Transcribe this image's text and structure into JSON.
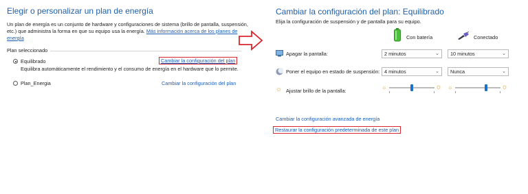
{
  "left": {
    "title": "Elegir o personalizar un plan de energía",
    "desc_line1": "Un plan de energía es un conjunto de hardware y configuraciones de sistema (brillo de pantalla, suspensión,",
    "desc_line2": "etc.) que administra la forma en que su equipo usa la energía.",
    "more_info_line1": "Más información acerca de los planes de",
    "more_info_line2": "energía",
    "section_label": "Plan seleccionado",
    "plans": [
      {
        "name": "Equilibrado",
        "selected": true,
        "description": "Equilibra automáticamente el rendimiento y el consumo de energía en el hardware que lo permite.",
        "change_link": "Cambiar la configuración del plan"
      },
      {
        "name": "Plan_Energia",
        "selected": false,
        "change_link": "Cambiar la configuración del plan"
      }
    ]
  },
  "right": {
    "title": "Cambiar la configuración del plan: Equilibrado",
    "subtitle": "Elija la configuración de suspensión y de pantalla para su equipo.",
    "col_battery": "Con batería",
    "col_plugged": "Conectado",
    "rows": [
      {
        "label": "Apagar la pantalla:",
        "battery": "2 minutos",
        "plugged": "10 minutos"
      },
      {
        "label": "Poner el equipo en estado de suspensión:",
        "battery": "4 minutos",
        "plugged": "Nunca"
      }
    ],
    "brightness_label": "Ajustar brillo de la pantalla:",
    "brightness_battery": 0.5,
    "brightness_plugged": 0.7,
    "advanced_link": "Cambiar la configuración avanzada de energía",
    "restore_link": "Restaurar la configuración predeterminada de este plan"
  },
  "colors": {
    "accent": "#1e5fa8",
    "link": "#1a5cb5",
    "highlight": "#d9262e",
    "arrow": "#d9262e",
    "slider": "#1f6fd1"
  }
}
